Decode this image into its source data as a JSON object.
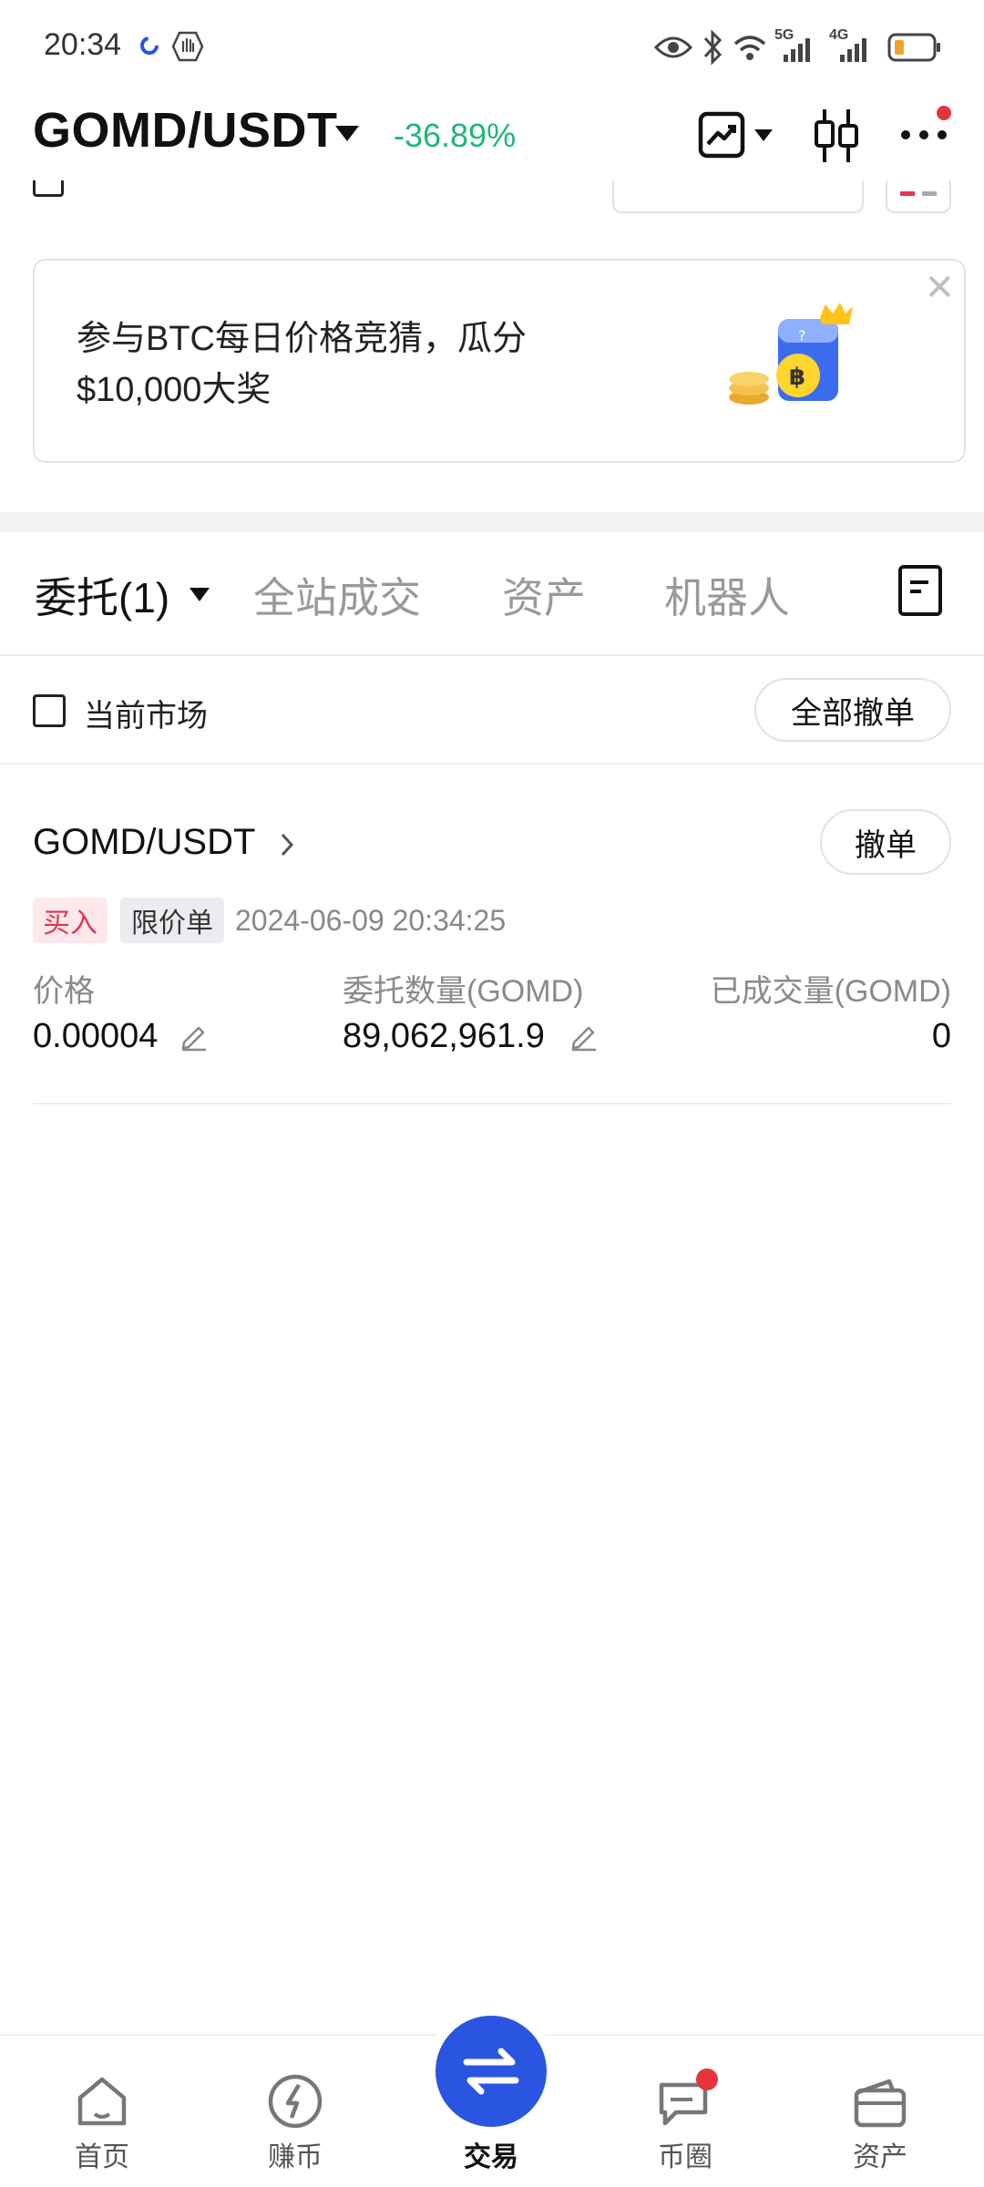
{
  "status_bar": {
    "time": "20:34",
    "network_labels": [
      "5G",
      "4G"
    ],
    "icons": [
      "sync-icon",
      "hand-icon",
      "eye-icon",
      "bluetooth-icon",
      "wifi-icon",
      "signal-icon",
      "battery-icon"
    ]
  },
  "header": {
    "pair": "GOMD/USDT",
    "change": "-36.89%",
    "change_color": "#1fb67a",
    "icons": [
      "chart-type-icon",
      "candlestick-icon",
      "more-icon"
    ]
  },
  "banner": {
    "text": "参与BTC每日价格竞猜，瓜分$10,000大奖",
    "close_icon": "close-icon"
  },
  "tabs": {
    "items": [
      {
        "label": "委托(1)",
        "active": true
      },
      {
        "label": "全站成交",
        "active": false
      },
      {
        "label": "资产",
        "active": false
      },
      {
        "label": "机器人",
        "active": false
      }
    ],
    "history_icon": "order-history-icon"
  },
  "filter": {
    "current_market_label": "当前市场",
    "checked": false,
    "cancel_all_label": "全部撤单"
  },
  "order": {
    "pair": "GOMD/USDT",
    "cancel_label": "撤单",
    "side": "买入",
    "type": "限价单",
    "time": "2024-06-09 20:34:25",
    "price_label": "价格",
    "price": "0.00004",
    "qty_label": "委托数量(GOMD)",
    "qty": "89,062,961.9",
    "filled_label": "已成交量(GOMD)",
    "filled": "0"
  },
  "nav": {
    "items": [
      {
        "label": "首页",
        "icon": "home-icon"
      },
      {
        "label": "赚币",
        "icon": "earn-icon"
      },
      {
        "label": "交易",
        "icon": "trade-icon",
        "active": true
      },
      {
        "label": "币圈",
        "icon": "community-icon"
      },
      {
        "label": "资产",
        "icon": "wallet-icon"
      }
    ]
  },
  "colors": {
    "accent": "#2a55e0",
    "buy_badge_bg": "#fde9ec",
    "buy_badge_text": "#e5344e",
    "notification_dot": "#e5353b"
  }
}
